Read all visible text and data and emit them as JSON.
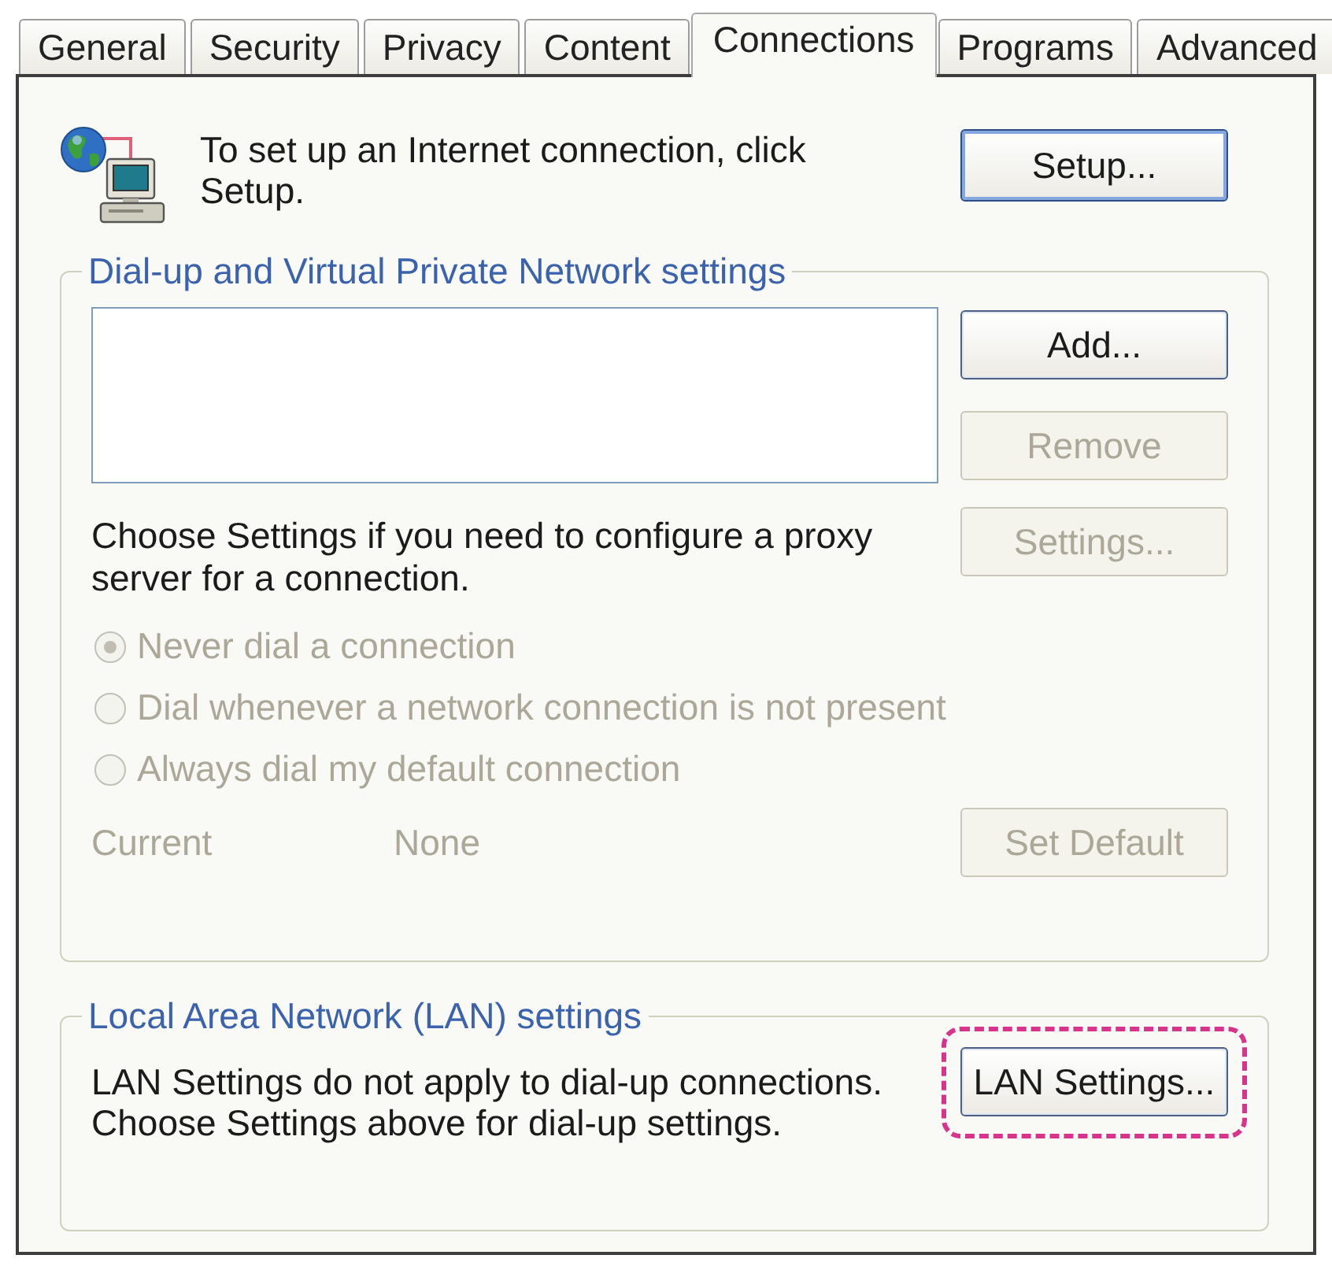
{
  "tabs": [
    {
      "label": "General",
      "selected": false
    },
    {
      "label": "Security",
      "selected": false
    },
    {
      "label": "Privacy",
      "selected": false
    },
    {
      "label": "Content",
      "selected": false
    },
    {
      "label": "Connections",
      "selected": true
    },
    {
      "label": "Programs",
      "selected": false
    },
    {
      "label": "Advanced",
      "selected": false
    }
  ],
  "intro": {
    "text": "To set up an Internet connection, click Setup.",
    "button": {
      "label": "Setup...",
      "disabled": false,
      "default": true
    }
  },
  "dialup_group": {
    "title": "Dial-up and Virtual Private Network settings",
    "buttons": [
      {
        "label": "Add...",
        "disabled": false
      },
      {
        "label": "Remove",
        "disabled": true
      }
    ],
    "proxy_text": "Choose Settings if you need to configure a proxy server for a connection.",
    "settings_button": {
      "label": "Settings...",
      "disabled": true
    },
    "dial_options": [
      {
        "label": "Never dial a connection",
        "selected": true,
        "disabled": true
      },
      {
        "label": "Dial whenever a network connection is not present",
        "selected": false,
        "disabled": true
      },
      {
        "label": "Always dial my default connection",
        "selected": false,
        "disabled": true
      }
    ],
    "current": {
      "label": "Current",
      "value": "None",
      "disabled": true
    },
    "set_default_button": {
      "label": "Set Default",
      "disabled": true
    }
  },
  "lan_group": {
    "title": "Local Area Network (LAN) settings",
    "text": "LAN Settings do not apply to dial-up connections. Choose Settings above for dial-up settings.",
    "button": {
      "label": "LAN Settings...",
      "disabled": false,
      "highlighted": true
    }
  }
}
